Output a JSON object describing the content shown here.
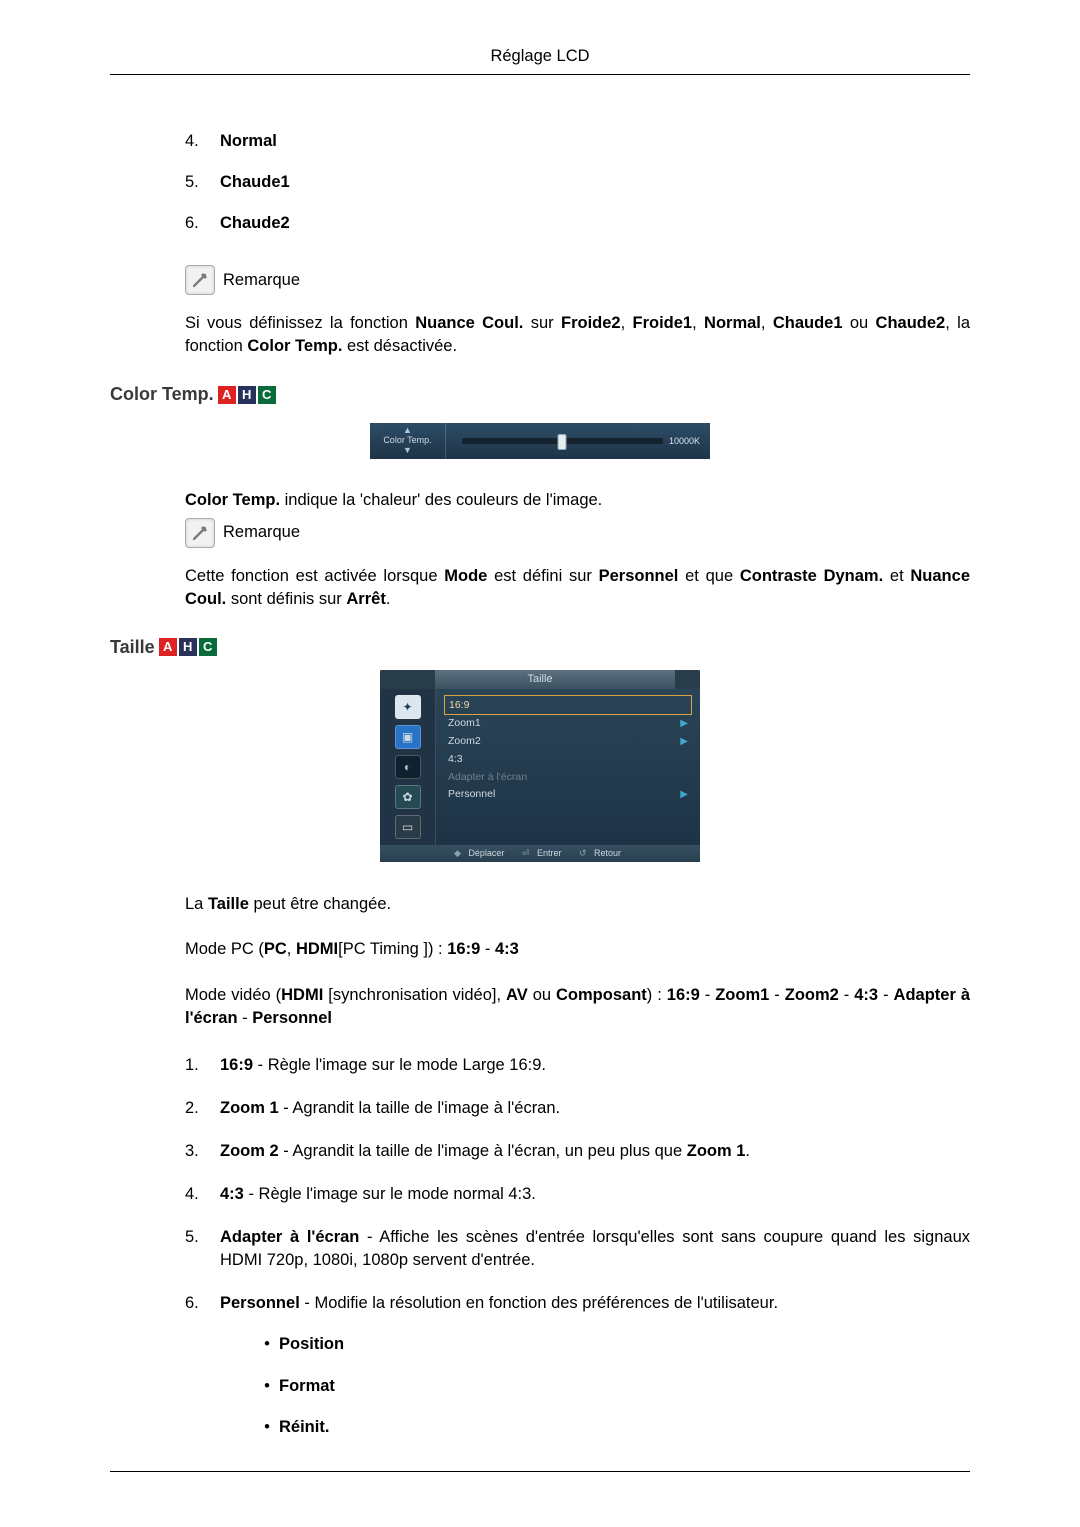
{
  "header": {
    "title": "Réglage LCD"
  },
  "list_top": {
    "items": [
      {
        "num": "4.",
        "label": "Normal"
      },
      {
        "num": "5.",
        "label": "Chaude1"
      },
      {
        "num": "6.",
        "label": "Chaude2"
      }
    ]
  },
  "remarque_label_1": "Remarque",
  "remarque_para_1": {
    "p1": "Si vous définissez la fonction ",
    "b1": "Nuance Coul.",
    "p2": " sur ",
    "b2": "Froide2",
    "p3": ", ",
    "b3": "Froide1",
    "p4": ", ",
    "b4": "Normal",
    "p5": ", ",
    "b5": "Chaude1",
    "p6": " ou ",
    "b6": "Chaude2",
    "p7": ", la fonction ",
    "b7": "Color Temp.",
    "p8": " est désactivée."
  },
  "section_colortemp": {
    "title": "Color Temp.",
    "badges": {
      "a": "A",
      "h": "H",
      "c": "C"
    },
    "panel": {
      "left_label": "Color Temp.",
      "arrow_up": "▲",
      "arrow_down": "▼",
      "value": "10000K"
    },
    "desc": {
      "b1": "Color Temp.",
      "t1": " indique la 'chaleur' des couleurs de l'image."
    }
  },
  "remarque_label_2": "Remarque",
  "remarque_para_2": {
    "p1": "Cette fonction est activée lorsque ",
    "b1": "Mode",
    "p2": " est défini sur ",
    "b2": "Personnel",
    "p3": " et que ",
    "b3": "Contraste Dynam.",
    "p4": " et ",
    "b4": "Nuance Coul.",
    "p5": " sont définis sur ",
    "b5": "Arrêt",
    "p6": "."
  },
  "section_taille": {
    "title": "Taille",
    "badges": {
      "a": "A",
      "h": "H",
      "c": "C"
    },
    "menu": {
      "title": "Taille",
      "items": [
        {
          "label": "16:9",
          "hl": true,
          "arrow": false,
          "dim": false
        },
        {
          "label": "Zoom1",
          "hl": false,
          "arrow": true,
          "dim": false
        },
        {
          "label": "Zoom2",
          "hl": false,
          "arrow": true,
          "dim": false
        },
        {
          "label": "4:3",
          "hl": false,
          "arrow": false,
          "dim": false
        },
        {
          "label": "Adapter à l'écran",
          "hl": false,
          "arrow": false,
          "dim": true
        },
        {
          "label": "Personnel",
          "hl": false,
          "arrow": true,
          "dim": false
        }
      ],
      "footer": {
        "move": "Déplacer",
        "enter": "Entrer",
        "return": "Retour"
      }
    },
    "intro": {
      "p1": "La ",
      "b1": "Taille",
      "p2": " peut être changée."
    },
    "mode_pc": {
      "p1": "Mode PC (",
      "b1": "PC",
      "p2": ", ",
      "b2": "HDMI",
      "p3": "[PC Timing ]) : ",
      "b3": "16:9",
      "p4": " - ",
      "b4": "4:3"
    },
    "mode_video": {
      "p1": "Mode vidéo (",
      "b1": "HDMI",
      "p2": " [synchronisation vidéo], ",
      "b2": "AV",
      "p3": " ou ",
      "b3": "Composant",
      "p4": ") : ",
      "b4": "16:9",
      "p5": " - ",
      "b5": "Zoom1",
      "p6": " - ",
      "b6": "Zoom2",
      "p7": " - ",
      "b7": "4:3",
      "p8": " - ",
      "b8": "Adapter à l'écran",
      "p9": " - ",
      "b9": "Personnel"
    },
    "list": [
      {
        "num": "1.",
        "b": "16:9",
        "t": " - Règle l'image sur le mode Large 16:9."
      },
      {
        "num": "2.",
        "b": "Zoom 1",
        "t": " - Agrandit la taille de l'image à l'écran."
      },
      {
        "num": "3.",
        "b": "Zoom 2",
        "t": " - Agrandit la taille de l'image à l'écran, un peu plus que ",
        "b2": "Zoom 1",
        "t2": "."
      },
      {
        "num": "4.",
        "b": "4:3",
        "t": " - Règle l'image sur le mode normal 4:3."
      },
      {
        "num": "5.",
        "b": "Adapter à l'écran",
        "t": " - Affiche les scènes d'entrée lorsqu'elles sont sans coupure quand les signaux HDMI 720p, 1080i, 1080p servent d'entrée."
      },
      {
        "num": "6.",
        "b": "Personnel",
        "t": " - Modifie la résolution en fonction des préférences de l'utilisateur."
      }
    ],
    "sublist": [
      "Position",
      "Format",
      "Réinit."
    ]
  }
}
